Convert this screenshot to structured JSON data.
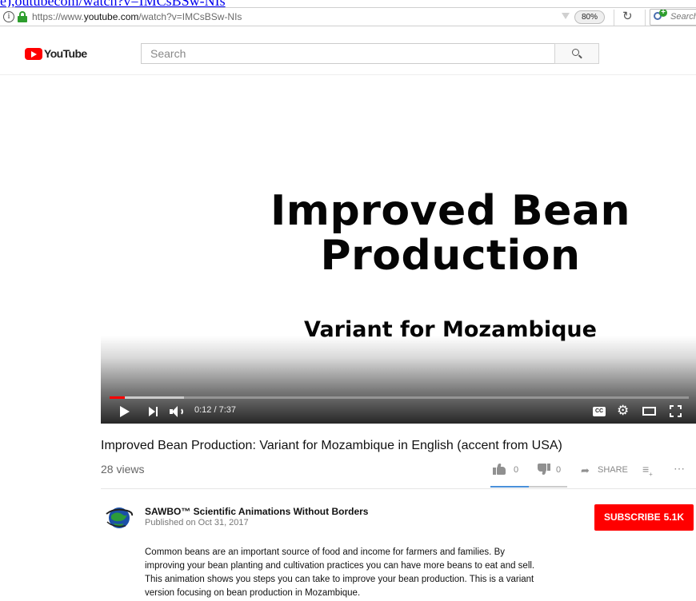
{
  "page": {
    "top_link": "e),outubecom/watch?v=IMCsBSw-NIs"
  },
  "browser": {
    "url_prefix": "https://www.",
    "url_domain": "youtube.com",
    "url_path": "/watch?v=IMCsBSw-NIs",
    "zoom": "80%",
    "search_placeholder": "Search",
    "lock_color": "#2e9e2e"
  },
  "youtube": {
    "logo_text": "YouTube",
    "search_placeholder": "Search",
    "brand_color": "#ff0000"
  },
  "player": {
    "slide_title_line1": "Improved Bean",
    "slide_title_line2": "Production",
    "slide_subtitle": "Variant for Mozambique",
    "time": "0:12 / 7:37",
    "progress_played_fraction": 0.026,
    "progress_buffered_fraction": 0.128,
    "cc_label": "CC",
    "icons": [
      "play-icon",
      "next-icon",
      "volume-icon",
      "captions-icon",
      "gear-icon",
      "theater-icon",
      "fullscreen-icon"
    ]
  },
  "video": {
    "title": "Improved Bean Production: Variant for Mozambique in English (accent from USA)",
    "views": "28 views",
    "likes": "0",
    "dislikes": "0",
    "share_label": "SHARE",
    "sentiment_fraction": 0.5
  },
  "channel": {
    "name": "SAWBO™ Scientific Animations Without Borders",
    "published": "Published on Oct 31, 2017",
    "subscribe_label": "SUBSCRIBE",
    "subscriber_count": "5.1K"
  },
  "description": {
    "lines": [
      "Common beans are an important source of food and income for farmers and families. By",
      "improving your bean planting and cultivation practices you can have more beans to eat and sell.",
      "This animation shows you steps you can take to improve your bean production. This is a variant",
      "version focusing on bean production in Mozambique."
    ]
  }
}
